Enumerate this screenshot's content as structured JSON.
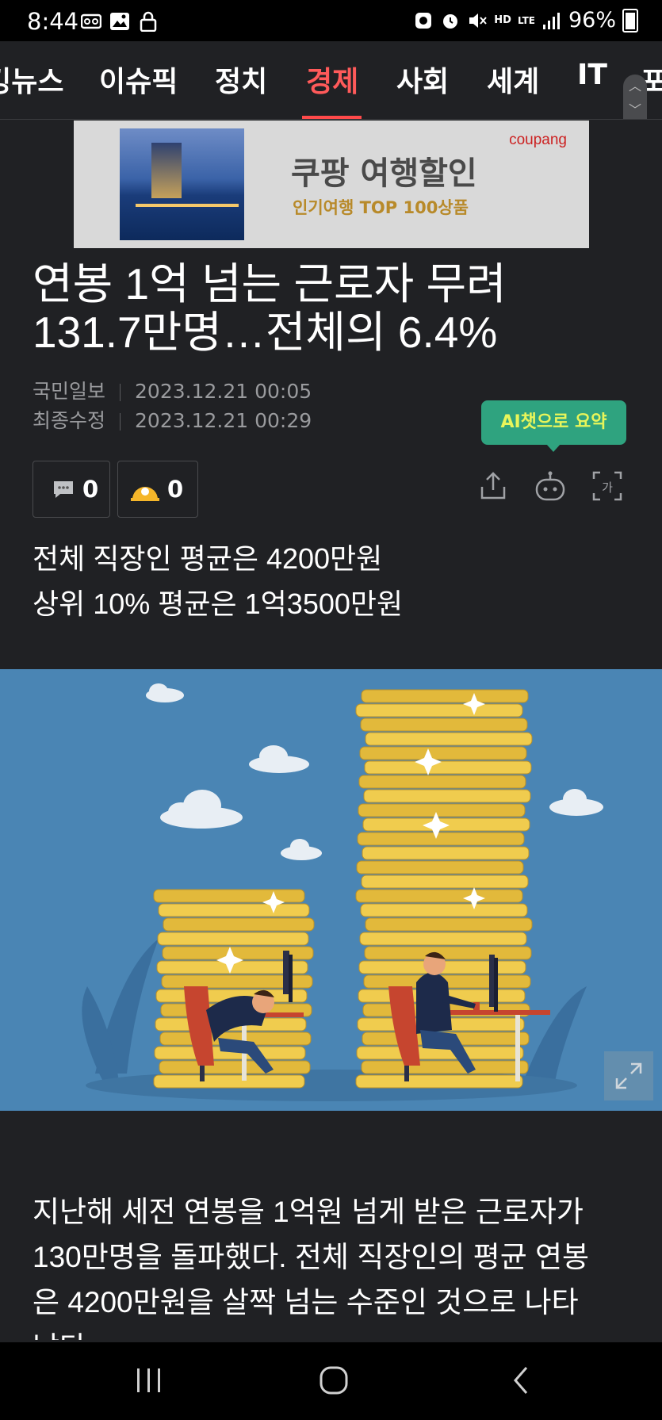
{
  "status": {
    "time": "8:44",
    "battery": "96%",
    "network": "LTE",
    "hd_label": "HD"
  },
  "nav": {
    "tabs": [
      {
        "label": "랭킹뉴스"
      },
      {
        "label": "이슈픽"
      },
      {
        "label": "정치"
      },
      {
        "label": "경제",
        "active": true
      },
      {
        "label": "사회"
      },
      {
        "label": "세계"
      },
      {
        "label": "IT"
      },
      {
        "label": "포토"
      }
    ]
  },
  "ad": {
    "brand": "coupang",
    "title": "쿠팡 여행할인",
    "subtitle": "인기여행 TOP 100상품"
  },
  "article": {
    "headline_line1": "연봉 1억 넘는 근로자 무려",
    "headline_line2": "131.7만명…전체의 6.4%",
    "publisher": "국민일보",
    "published_at": "2023.12.21 00:05",
    "modified_label": "최종수정",
    "modified_at": "2023.12.21 00:29",
    "ai_summary_label": "AI챗으로 요약",
    "comment_count": "0",
    "reaction_count": "0",
    "subtitle_line1": "전체 직장인 평균은 4200만원",
    "subtitle_line2": "상위 10% 평균은 1억3500만원",
    "body_line1": "지난해 세전 연봉을 1억원 넘게 받은 근로자가",
    "body_line2": "130만명을 돌파했다. 전체 직장인의 평균 연봉",
    "body_line3": "은 4200만원을 살짝 넘는 수준인 것으로 나타",
    "body_line4": "났다."
  },
  "colors": {
    "accent": "#ff4a4a",
    "background": "#202124",
    "ai_button": "#2fa37f",
    "illustration_sky": "#4a85b4"
  },
  "icons": [
    "share-icon",
    "bot-icon",
    "font-size-icon",
    "comment-icon",
    "reaction-icon",
    "expand-icon"
  ]
}
